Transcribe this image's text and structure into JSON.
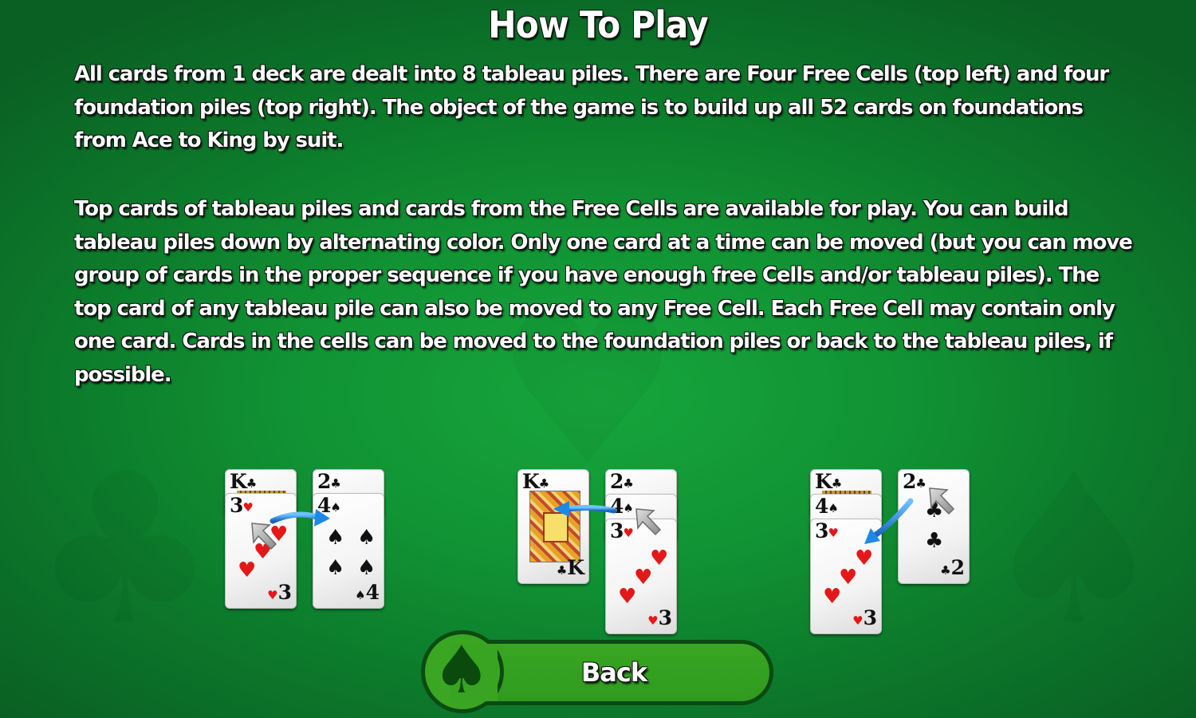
{
  "title": "How To Play",
  "paragraphs": [
    "All cards from 1 deck are dealt into 8 tableau piles. There are Four Free Cells (top left) and four foundation piles (top right). The object of the game is to build up all 52 cards on foundations from Ace to King by suit.",
    "Top cards of tableau piles and cards from the Free Cells are available for play. You can build tableau piles down by alternating color. Only one card at a time can be moved (but you can move group of cards in the proper sequence if you have enough free Cells and/or tableau piles). The top card of any tableau pile can also be moved to any Free Cell. Each Free Cell may contain only one card. Cards in the cells can be moved to the foundation piles or back to the tableau piles, if possible."
  ],
  "examples": [
    {
      "label": "Move 3 of hearts onto 4 of spades",
      "left_pile": [
        {
          "rank": "K",
          "suit": "♣"
        },
        {
          "rank": "3",
          "suit": "♥"
        }
      ],
      "right_pile": [
        {
          "rank": "2",
          "suit": "♣"
        },
        {
          "rank": "4",
          "suit": "♠"
        }
      ]
    },
    {
      "label": "Move 4 of spades and 3 of hearts onto King of clubs",
      "left_pile": [
        {
          "rank": "K",
          "suit": "♣"
        }
      ],
      "right_pile": [
        {
          "rank": "2",
          "suit": "♣"
        },
        {
          "rank": "4",
          "suit": "♠"
        },
        {
          "rank": "3",
          "suit": "♥"
        }
      ]
    },
    {
      "label": "Move 2 of clubs onto 3 of hearts",
      "left_pile": [
        {
          "rank": "K",
          "suit": "♣"
        },
        {
          "rank": "4",
          "suit": "♠"
        },
        {
          "rank": "3",
          "suit": "♥"
        }
      ],
      "right_pile": [
        {
          "rank": "2",
          "suit": "♣"
        }
      ]
    }
  ],
  "icons": {
    "move_arrow": "blue-curved-arrow-icon",
    "pointer": "mouse-cursor-icon",
    "spade": "♠"
  },
  "back_button": {
    "label": "Back",
    "icon": "♠"
  },
  "colors": {
    "felt_center": "#16a53c",
    "felt_edge": "#0a5f23",
    "button_green": "#3aa622",
    "button_border": "#0b4a12",
    "heart_red": "#e31919",
    "arrow_blue": "#1e88e5"
  }
}
